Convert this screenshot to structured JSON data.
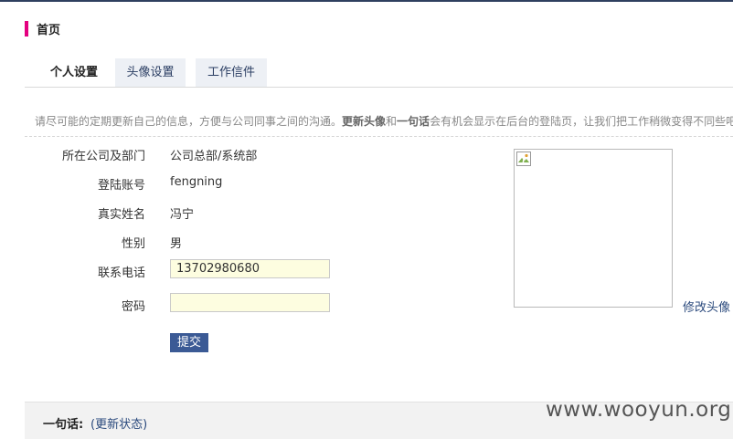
{
  "header": {
    "title": "首页",
    "accent_color": "#e4007f"
  },
  "tabs": [
    {
      "label": "个人设置",
      "active": true
    },
    {
      "label": "头像设置",
      "active": false
    },
    {
      "label": "工作信件",
      "active": false
    }
  ],
  "tip": {
    "prefix": "请尽可能的定期更新自己的信息，方便与公司同事之间的沟通。",
    "highlight1": "更新头像",
    "middle": "和",
    "highlight2": "一句话",
    "suffix": "会有机会显示在后台的登陆页，让我们把工作稍微变得不同些吧"
  },
  "profile": {
    "company_label": "所在公司及部门",
    "company_value": "公司总部/系统部",
    "account_label": "登陆账号",
    "account_value": "fengning",
    "name_label": "真实姓名",
    "name_value": "冯宁",
    "gender_label": "性别",
    "gender_value": "男",
    "phone_label": "联系电话",
    "phone_value": "13702980680",
    "password_label": "密码",
    "password_value": "",
    "submit_label": "提交"
  },
  "avatar": {
    "change_label": "修改头像",
    "image_icon": "broken-image-icon"
  },
  "status": {
    "label": "一句话:",
    "link": "(更新状态)"
  },
  "watermark": "www.wooyun.org"
}
